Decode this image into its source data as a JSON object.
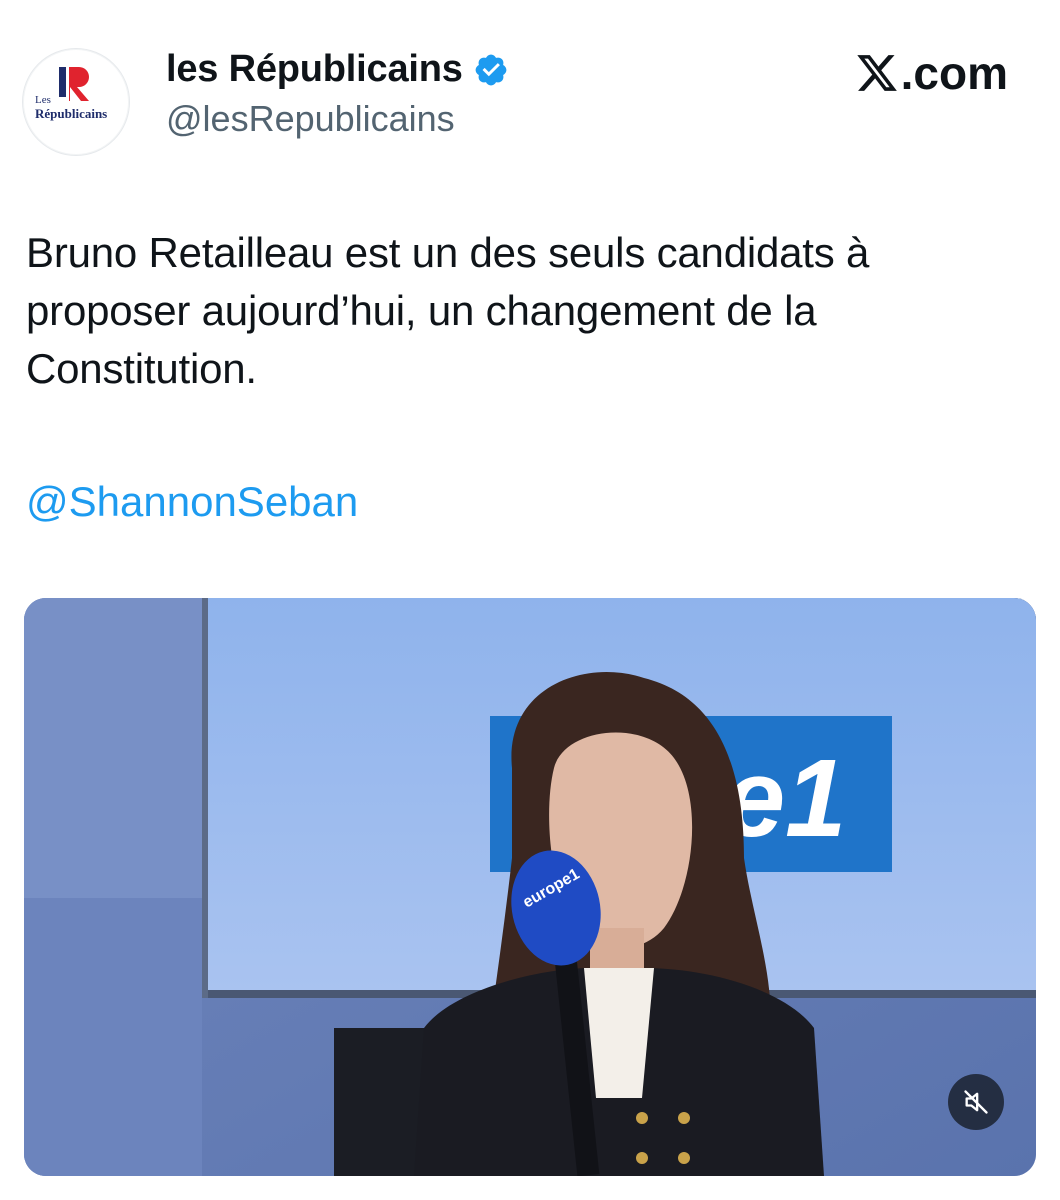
{
  "author": {
    "display_name": "les Républicains",
    "handle": "@lesRepublicains",
    "avatar_logo_text": "Les Républicains",
    "verified_icon": "verified-badge-icon"
  },
  "site": {
    "label": ".com",
    "logo_icon": "x-logo-icon"
  },
  "tweet": {
    "text": "Bruno Retailleau est un des seuls candidats à proposer aujourd’hui, un changement de la Constitution.",
    "mention": "@ShannonSeban"
  },
  "media": {
    "type": "video",
    "studio_sign_text": "e1",
    "mic_flag_text": "europe1",
    "controls": {
      "mute_icon": "muted-speaker-icon"
    }
  },
  "colors": {
    "link": "#1d9bf0",
    "verified": "#1d9bf0",
    "text": "#0f1419",
    "secondary": "#536471"
  }
}
